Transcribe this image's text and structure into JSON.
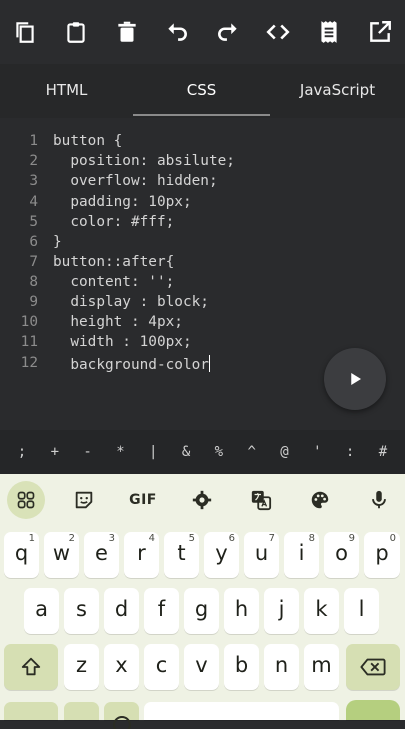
{
  "toolbar": {
    "buttons": [
      {
        "name": "copy-button",
        "icon": "copy-icon"
      },
      {
        "name": "paste-button",
        "icon": "clipboard-icon"
      },
      {
        "name": "delete-button",
        "icon": "trash-icon"
      },
      {
        "name": "undo-button",
        "icon": "undo-icon"
      },
      {
        "name": "redo-button",
        "icon": "redo-icon"
      },
      {
        "name": "code-button",
        "icon": "code-icon"
      },
      {
        "name": "log-button",
        "icon": "receipt-icon"
      },
      {
        "name": "open-external-button",
        "icon": "open-external-icon"
      }
    ]
  },
  "tabs": {
    "html": "HTML",
    "css": "CSS",
    "javascript": "JavaScript",
    "active": "CSS"
  },
  "code": {
    "lines": [
      {
        "no": "1",
        "text": "button {"
      },
      {
        "no": "2",
        "text": "  position: absilute;"
      },
      {
        "no": "3",
        "text": "  overflow: hidden;"
      },
      {
        "no": "4",
        "text": "  padding: 10px;"
      },
      {
        "no": "5",
        "text": "  color: #fff;"
      },
      {
        "no": "6",
        "text": "}"
      },
      {
        "no": "7",
        "text": "button::after{"
      },
      {
        "no": "8",
        "text": "  content: '';"
      },
      {
        "no": "9",
        "text": "  display : block;"
      },
      {
        "no": "10",
        "text": "  height : 4px;"
      },
      {
        "no": "11",
        "text": "  width : 100px;"
      },
      {
        "no": "12",
        "text": "  background-color"
      }
    ]
  },
  "symbols": [
    ";",
    "+",
    "-",
    "*",
    "|",
    "&",
    "%",
    "^",
    "@",
    "'",
    ":",
    "#"
  ],
  "keyboard": {
    "gif_label": "GIF",
    "row1": [
      {
        "k": "q",
        "h": "1"
      },
      {
        "k": "w",
        "h": "2"
      },
      {
        "k": "e",
        "h": "3"
      },
      {
        "k": "r",
        "h": "4"
      },
      {
        "k": "t",
        "h": "5"
      },
      {
        "k": "y",
        "h": "6"
      },
      {
        "k": "u",
        "h": "7"
      },
      {
        "k": "i",
        "h": "8"
      },
      {
        "k": "o",
        "h": "9"
      },
      {
        "k": "p",
        "h": "0"
      }
    ],
    "row2": [
      "a",
      "s",
      "d",
      "f",
      "g",
      "h",
      "j",
      "k",
      "l"
    ],
    "row3": [
      "z",
      "x",
      "c",
      "v",
      "b",
      "n",
      "m"
    ]
  },
  "colors": {
    "editor_bg": "#2a2b2d",
    "keyboard_bg": "#eff2e4",
    "accent_key": "#d6dfb3"
  }
}
